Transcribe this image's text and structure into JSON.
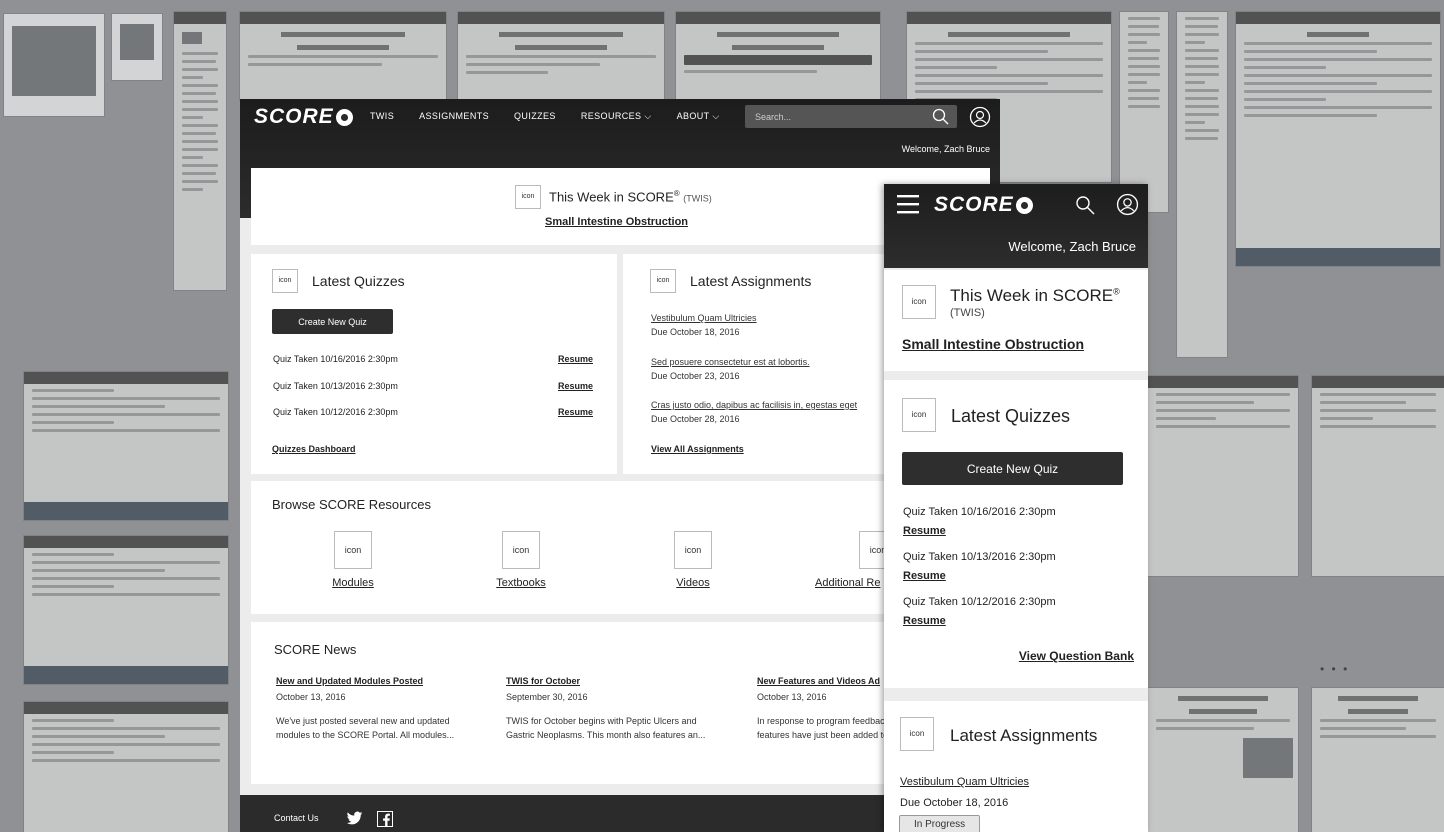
{
  "brand": {
    "logo_text": "SCORE"
  },
  "desktop": {
    "nav": [
      "TWIS",
      "ASSIGNMENTS",
      "QUIZZES",
      "RESOURCES ⌵",
      "ABOUT ⌵"
    ],
    "search_placeholder": "Search...",
    "welcome": "Welcome, Zach Bruce",
    "twis": {
      "icon": "icon",
      "title": "This Week in SCORE",
      "reg": "®",
      "abbr": "(TWIS)",
      "topic": "Small Intestine Obstruction"
    },
    "quizzes": {
      "icon": "icon",
      "title": "Latest Quizzes",
      "create": "Create New Quiz",
      "items": [
        {
          "label": "Quiz Taken 10/16/2016 2:30pm",
          "action": "Resume"
        },
        {
          "label": "Quiz Taken 10/13/2016 2:30pm",
          "action": "Resume"
        },
        {
          "label": "Quiz Taken 10/12/2016 2:30pm",
          "action": "Resume"
        }
      ],
      "dashboard": "Quizzes Dashboard"
    },
    "assignments": {
      "icon": "icon",
      "title": "Latest Assignments",
      "items": [
        {
          "title": "Vestibulum Quam Ultricies",
          "due": "Due October 18, 2016"
        },
        {
          "title": "Sed posuere consectetur est at lobortis.",
          "due": "Due October 23, 2016"
        },
        {
          "title": "Cras justo odio, dapibus ac facilisis in, egestas eget",
          "due": "Due October 28, 2016"
        }
      ],
      "view_all": "View All Assignments"
    },
    "resources": {
      "title": "Browse SCORE Resources",
      "items": [
        {
          "icon": "icon",
          "label": "Modules"
        },
        {
          "icon": "icon",
          "label": "Textbooks"
        },
        {
          "icon": "icon",
          "label": "Videos"
        },
        {
          "icon": "icon",
          "label": "Additional Re"
        }
      ]
    },
    "news": {
      "title": "SCORE News",
      "items": [
        {
          "title": "New and Updated Modules Posted",
          "date": "October 13, 2016",
          "body1": "We've just posted several new and updated",
          "body2": "modules to the SCORE Portal. All modules..."
        },
        {
          "title": "TWIS for October",
          "date": "September 30, 2016",
          "body1": "TWIS for October begins with Peptic Ulcers and",
          "body2": "Gastric Neoplasms. This month also features an..."
        },
        {
          "title": "New Features and Videos Ad",
          "date": "October 13, 2016",
          "body1": "In response to program feedback",
          "body2": "features have just been added to"
        }
      ]
    },
    "footer": {
      "contact": "Contact Us"
    }
  },
  "mobile": {
    "welcome": "Welcome, Zach Bruce",
    "twis": {
      "icon": "icon",
      "title": "This Week in SCORE",
      "reg": "®",
      "abbr": "(TWIS)",
      "topic": "Small Intestine Obstruction"
    },
    "quizzes": {
      "icon": "icon",
      "title": "Latest Quizzes",
      "create": "Create New Quiz",
      "items": [
        {
          "label": "Quiz Taken 10/16/2016 2:30pm",
          "action": "Resume"
        },
        {
          "label": "Quiz Taken 10/13/2016 2:30pm",
          "action": "Resume"
        },
        {
          "label": "Quiz Taken 10/12/2016 2:30pm",
          "action": "Resume"
        }
      ],
      "bank": "View Question Bank"
    },
    "assignments": {
      "icon": "icon",
      "title": "Latest Assignments",
      "first": {
        "title": "Vestibulum Quam Ultricies",
        "due": "Due October 18, 2016",
        "status": "In Progress"
      }
    }
  },
  "colors": {
    "nav_bg": "#2a2a2a",
    "page_bg": "#ececec",
    "button_bg": "#2e2e2e",
    "collage_bg": "#8f9194"
  }
}
